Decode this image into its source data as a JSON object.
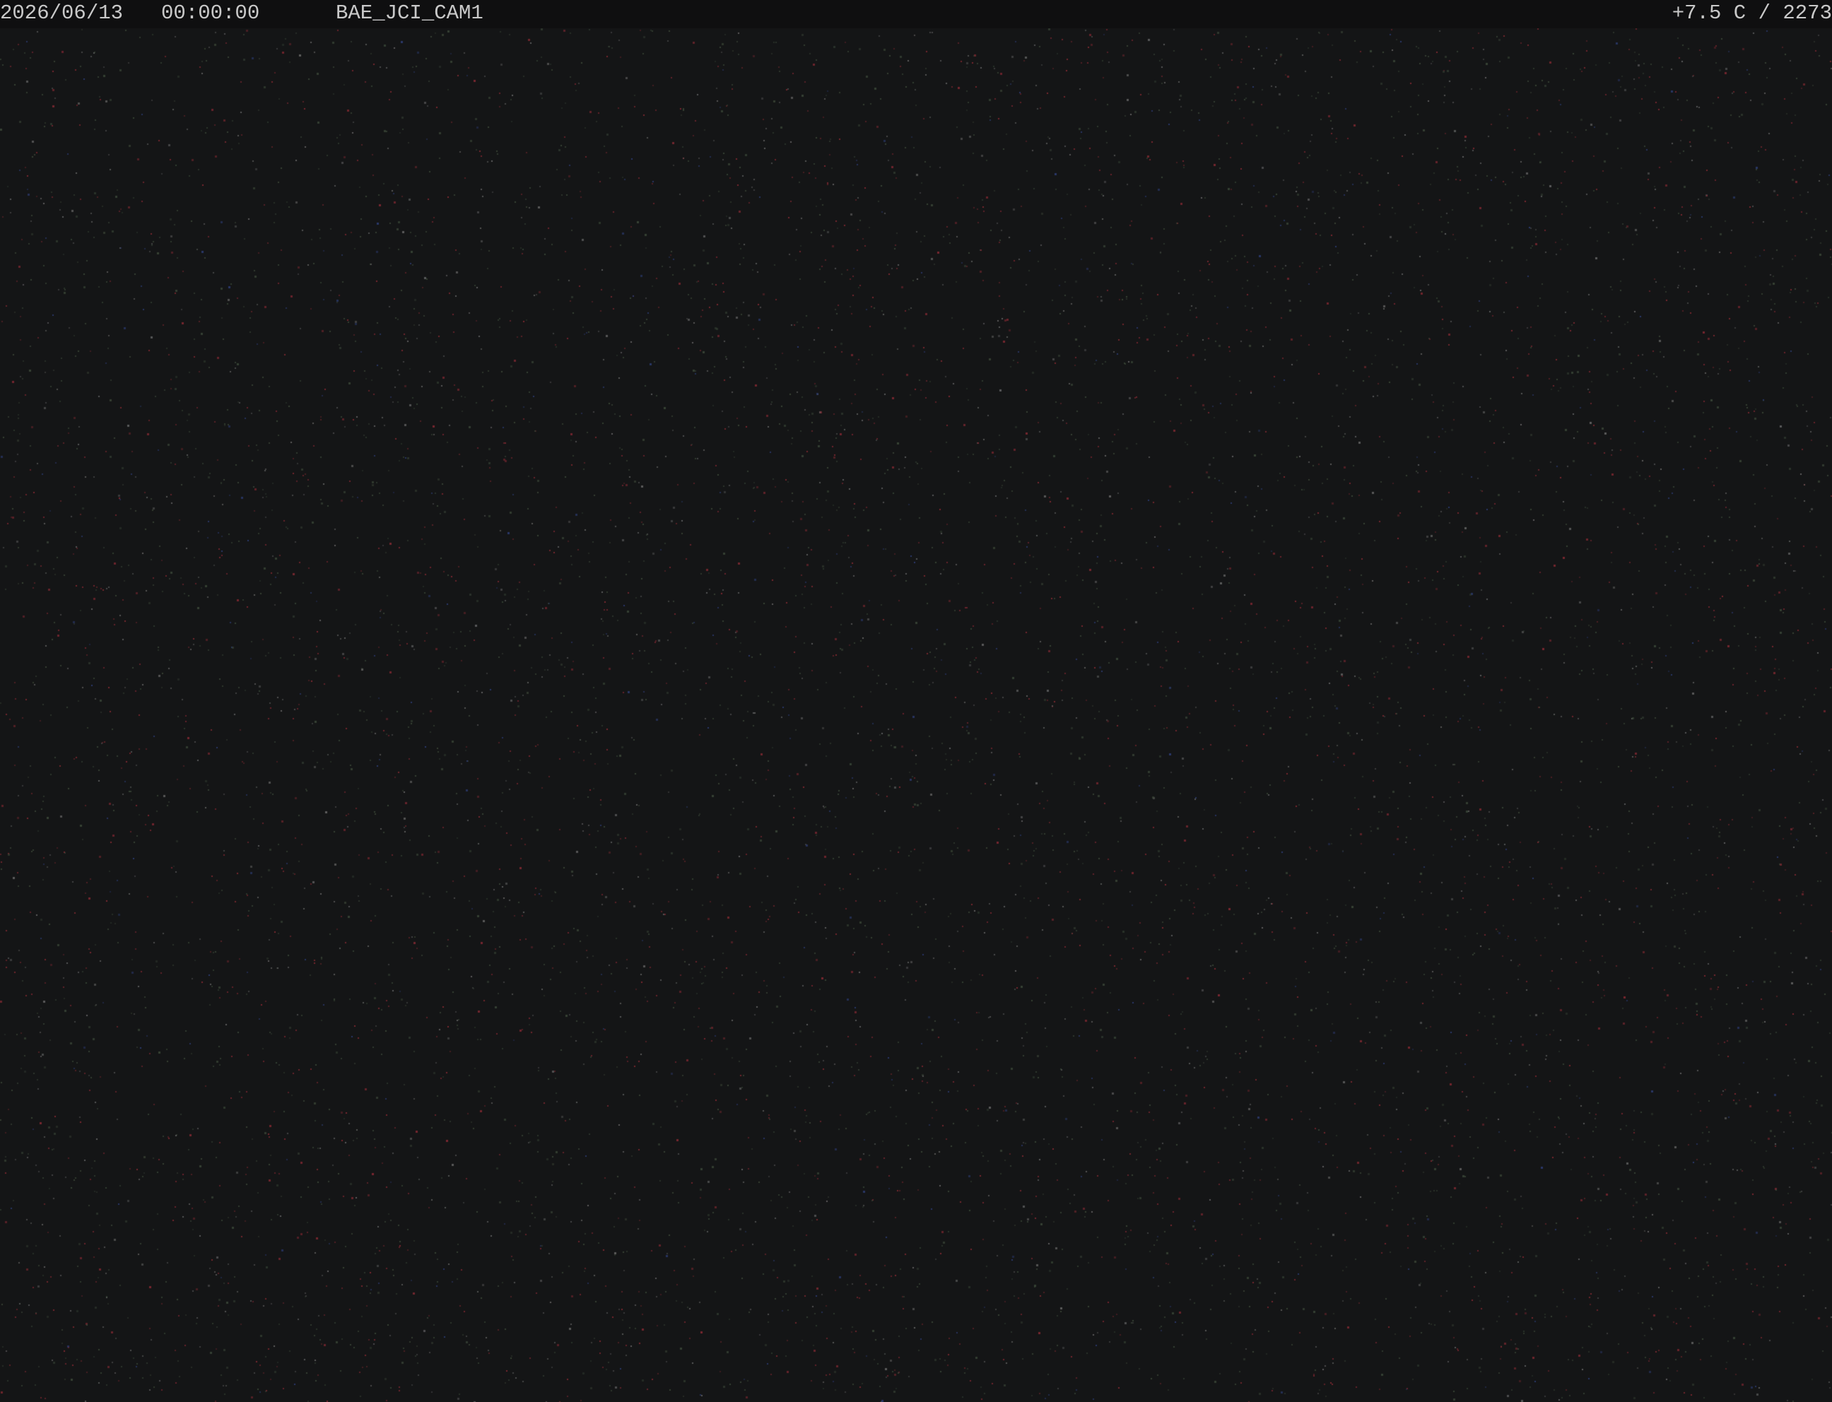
{
  "overlay": {
    "date": "2026/06/13",
    "time": "00:00:00",
    "camera_name": "BAE_JCI_CAM1",
    "status": "+7.5 C / 2273"
  },
  "scene": {
    "description_type": "night sky camera frame",
    "background_color": "#141516",
    "noise_colors": [
      "#8a2a34",
      "#2f3f7a",
      "#3d4a3a",
      "#6a6a6a"
    ]
  }
}
